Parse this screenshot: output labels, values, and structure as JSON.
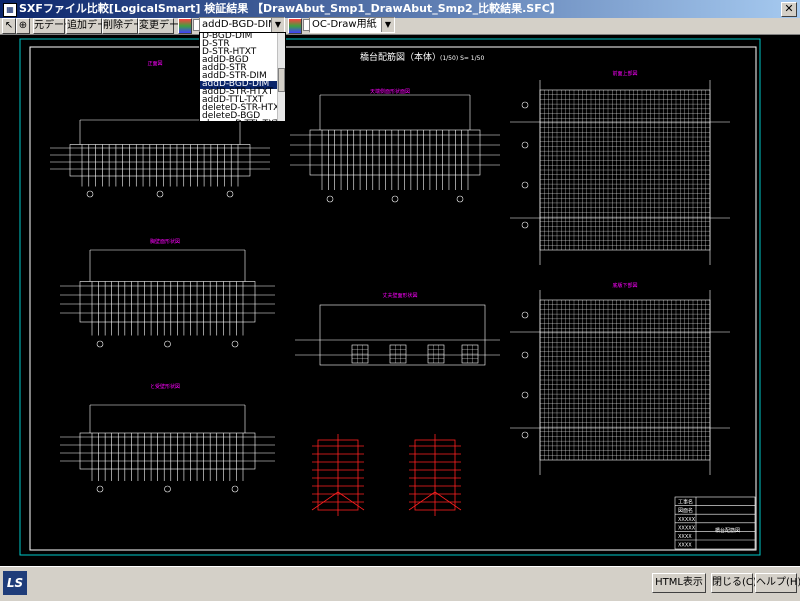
{
  "window": {
    "title": "SXFファイル比較[LogicalSmart] 検証結果 【DrawAbut_Smp1_DrawAbut_Smp2_比較結果.SFC】",
    "app_icon": "app-icon",
    "close_glyph": "✕"
  },
  "toolbar": {
    "icon_buttons": [
      "select-arrow-icon",
      "zoom-icon"
    ],
    "original_label": "元データ",
    "added_label": "追加データ",
    "deleted_label": "削除データ",
    "changed_label": "変更データ",
    "layer_value": "addD-BGD-DIM",
    "paper_value": "OC-Draw用紙",
    "layer_options": [
      "D-BGD-DIM",
      "D-STR",
      "D-STR-HTXT",
      "addD-BGD",
      "addD-STR",
      "addD-STR-DIM",
      "addD-BGD-DIM",
      "addD-STR-HTXT",
      "addD-TTL-TXT",
      "deleteD-STR-HTXT",
      "deleteD-BGD",
      "changeD-TTL-TXT"
    ],
    "selected_option_index": 6
  },
  "drawing": {
    "title": "橋台配筋図（本体）",
    "scale_text": "(1/50)   S= 1/50",
    "views": [
      {
        "label": "正面図",
        "pos": "top-left"
      },
      {
        "label": "天端側面形状面図",
        "pos": "top-middle"
      },
      {
        "label": "前面上部図",
        "pos": "top-right"
      },
      {
        "label": "胸壁面形状図",
        "pos": "mid-left"
      },
      {
        "label": "丈夫壁面形状図",
        "pos": "mid-center"
      },
      {
        "label": "底版下部図",
        "pos": "mid-right"
      },
      {
        "label": "と受壁形状図",
        "pos": "bottom-left"
      }
    ],
    "title_block_rows": [
      "工事名",
      "図面名",
      "XXXXX",
      "XXXXX",
      "XXXX",
      "XXXX"
    ],
    "title_block_name": "橋台配筋図"
  },
  "status": {
    "logo": "LS",
    "html_button": "HTML表示",
    "close_button": "閉じる(C)",
    "help_button": "ヘルプ(H)"
  },
  "colors": {
    "background": "#000000",
    "lines": "#ffffff",
    "magenta_labels": "#ff00ff",
    "red_details": "#ff2020",
    "cyan_border": "#00c8c8",
    "selection": "#0a246a"
  }
}
